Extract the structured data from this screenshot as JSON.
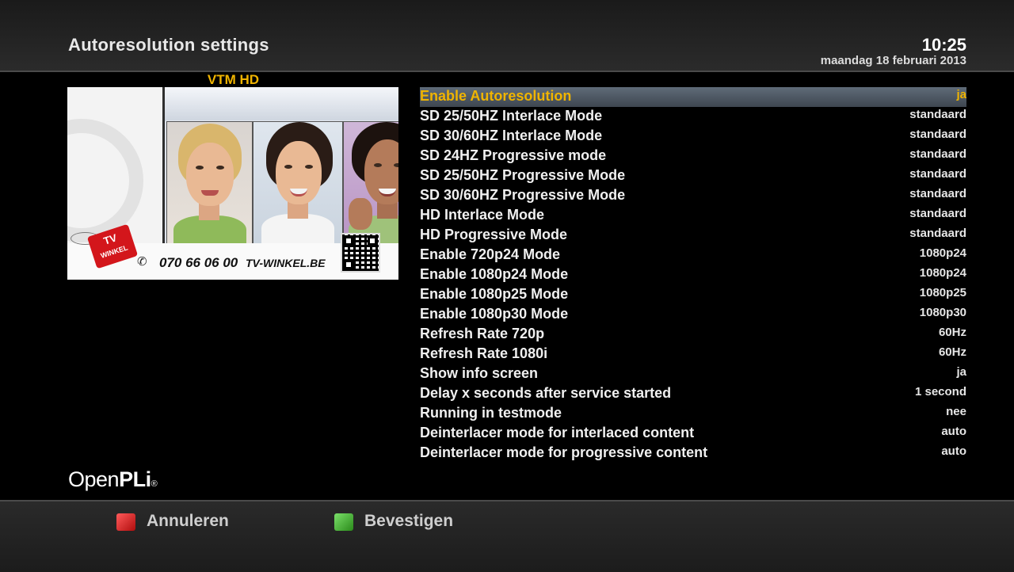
{
  "header": {
    "title": "Autoresolution settings",
    "time": "10:25",
    "date": "maandag 18 februari 2013"
  },
  "preview": {
    "channel": "VTM HD",
    "promo_tag_line1": "TV",
    "promo_tag_line2": "WINKEL",
    "promo_phone": "070 66 06 00",
    "promo_site": "TV-WINKEL.BE"
  },
  "settings": [
    {
      "label": "Enable Autoresolution",
      "value": "ja",
      "selected": true
    },
    {
      "label": "SD 25/50HZ Interlace Mode",
      "value": "standaard"
    },
    {
      "label": "SD 30/60HZ Interlace Mode",
      "value": "standaard"
    },
    {
      "label": "SD 24HZ Progressive mode",
      "value": "standaard"
    },
    {
      "label": "SD 25/50HZ Progressive Mode",
      "value": "standaard"
    },
    {
      "label": "SD 30/60HZ Progressive Mode",
      "value": "standaard"
    },
    {
      "label": "HD Interlace Mode",
      "value": "standaard"
    },
    {
      "label": "HD Progressive Mode",
      "value": "standaard"
    },
    {
      "label": "Enable 720p24 Mode",
      "value": "1080p24"
    },
    {
      "label": "Enable 1080p24 Mode",
      "value": "1080p24"
    },
    {
      "label": "Enable 1080p25 Mode",
      "value": "1080p25"
    },
    {
      "label": "Enable 1080p30 Mode",
      "value": "1080p30"
    },
    {
      "label": "Refresh Rate 720p",
      "value": "60Hz"
    },
    {
      "label": "Refresh Rate 1080i",
      "value": "60Hz"
    },
    {
      "label": "Show info screen",
      "value": "ja"
    },
    {
      "label": "Delay x seconds after service started",
      "value": "1 second"
    },
    {
      "label": "Running in testmode",
      "value": "nee"
    },
    {
      "label": "Deinterlacer mode for interlaced content",
      "value": "auto"
    },
    {
      "label": "Deinterlacer mode for progressive content",
      "value": "auto"
    }
  ],
  "logo": {
    "part1": "Open",
    "part2": "PLi",
    "mark": "®"
  },
  "footer": {
    "red_label": "Annuleren",
    "green_label": "Bevestigen"
  },
  "colors": {
    "selected_text": "#f0b400",
    "red_key": "#d01818",
    "green_key": "#3fae2a"
  }
}
